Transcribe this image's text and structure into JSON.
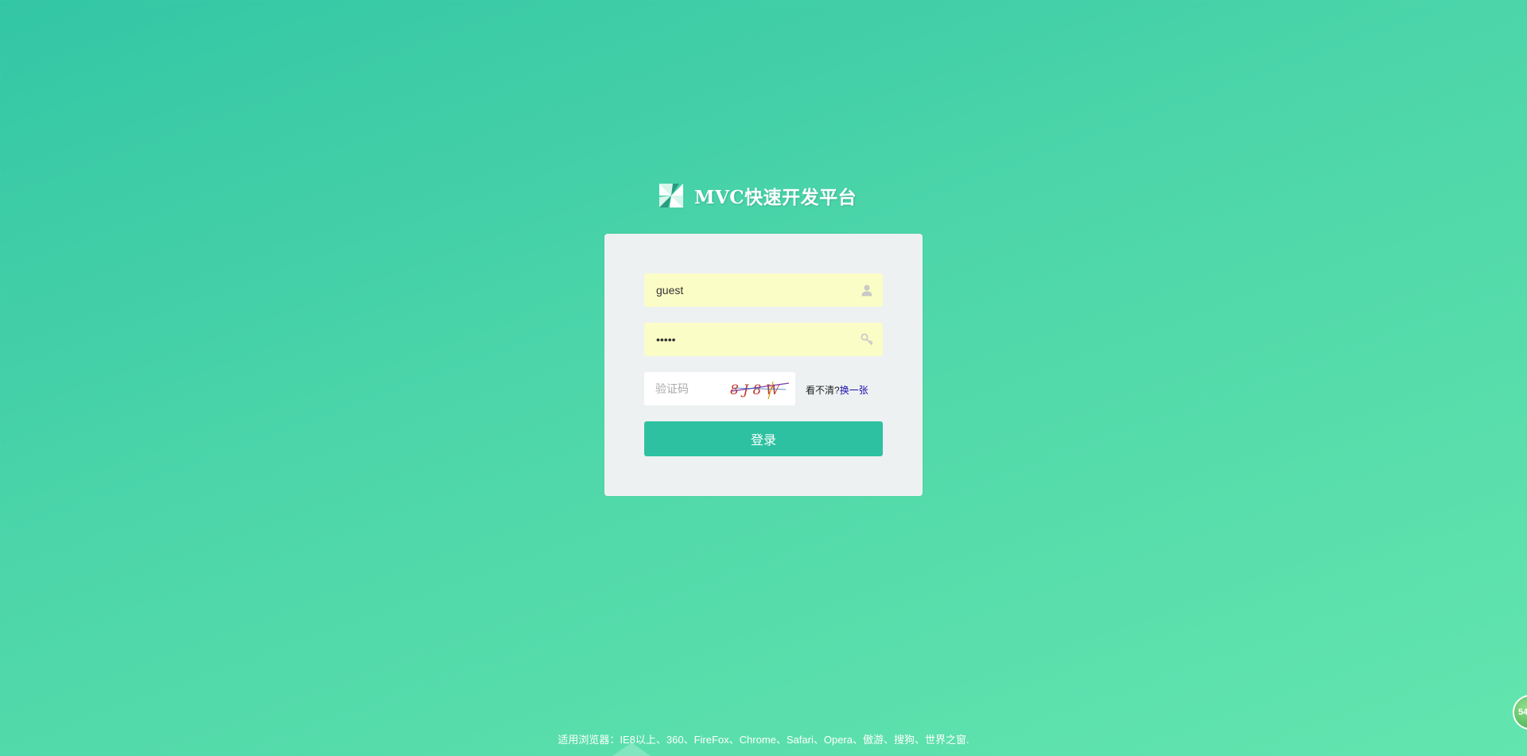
{
  "app": {
    "title": "MVC快速开发平台",
    "logo_icon": "pinwheel-logo-icon"
  },
  "login_form": {
    "username": {
      "value": "guest",
      "icon": "user-icon"
    },
    "password": {
      "value": "•••••",
      "icon": "key-icon"
    },
    "captcha": {
      "placeholder": "验证码",
      "image_text": "8 J 8 W",
      "help_text": "看不清?",
      "refresh_label": "换一张"
    },
    "submit_label": "登录"
  },
  "footer": {
    "browser_support": "适用浏览器：IE8以上、360、FireFox、Chrome、Safari、Opera、傲游、搜狗、世界之窗."
  },
  "corner_badge": {
    "text": "54"
  },
  "colors": {
    "background_start": "#33c6a5",
    "background_end": "#63e5ae",
    "card": "#eef1f2",
    "input_autofill": "#fbfdc6",
    "button": "#2ec1a1"
  }
}
